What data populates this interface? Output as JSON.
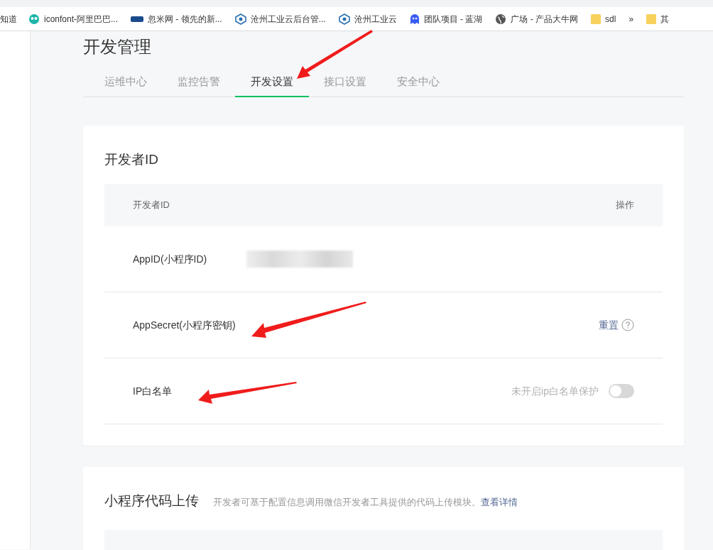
{
  "bookmarks": [
    {
      "label": "知道"
    },
    {
      "label": "iconfont-阿里巴巴..."
    },
    {
      "label": "忽米网 - 领先的新..."
    },
    {
      "label": "沧州工业云后台管..."
    },
    {
      "label": "沧州工业云"
    },
    {
      "label": "团队项目 - 蓝湖"
    },
    {
      "label": "广场 - 产品大牛网"
    },
    {
      "label": "sdl"
    },
    {
      "label": "»"
    },
    {
      "label": "其"
    }
  ],
  "page_title": "开发管理",
  "tabs": [
    {
      "label": "运维中心",
      "selected": false
    },
    {
      "label": "监控告警",
      "selected": false
    },
    {
      "label": "开发设置",
      "selected": true
    },
    {
      "label": "接口设置",
      "selected": false
    },
    {
      "label": "安全中心",
      "selected": false
    }
  ],
  "developer_card": {
    "title": "开发者ID",
    "columns": [
      "开发者ID",
      "操作"
    ],
    "rows": [
      {
        "kind": "value",
        "label": "AppID(小程序ID)"
      },
      {
        "kind": "action",
        "label": "AppSecret(小程序密钥)",
        "action": "重置"
      },
      {
        "kind": "toggle",
        "label": "IP白名单",
        "toggle_label": "未开启ip白名单保护",
        "on": false
      }
    ]
  },
  "upload_card": {
    "title": "小程序代码上传",
    "description": "开发者可基于配置信息调用微信开发者工具提供的代码上传模块。",
    "link": "查看详情"
  }
}
